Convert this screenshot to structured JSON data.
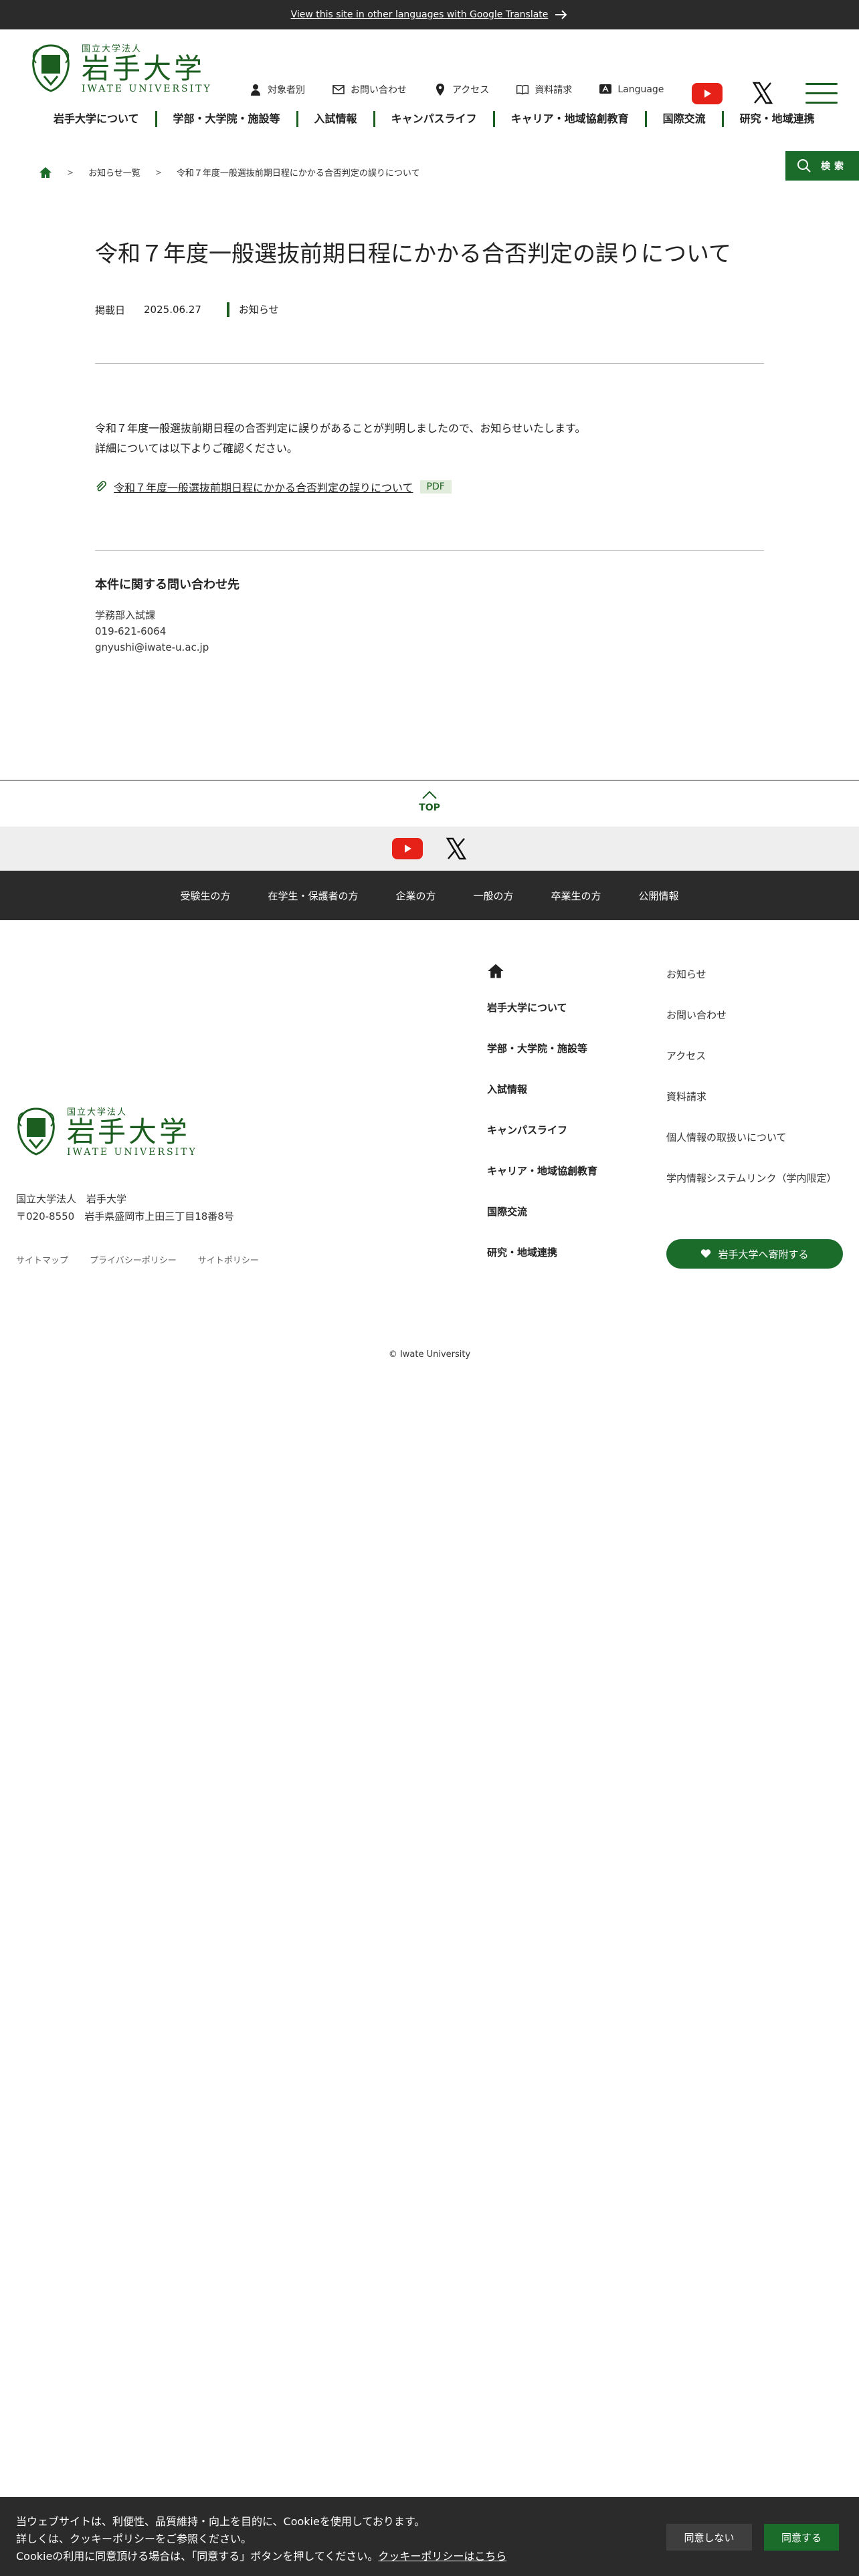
{
  "topbar": {
    "translate_link": "View this site in other languages with Google Translate"
  },
  "logo": {
    "small": "国立大学法人",
    "big": "岩手大学",
    "en": "IWATE UNIVERSITY"
  },
  "util_nav": [
    {
      "label": "対象者別",
      "icon": "person-icon"
    },
    {
      "label": "お問い合わせ",
      "icon": "mail-icon"
    },
    {
      "label": "アクセス",
      "icon": "map-pin-icon"
    },
    {
      "label": "資料請求",
      "icon": "book-icon"
    },
    {
      "label": "Language",
      "icon": "language-icon"
    }
  ],
  "global_nav": [
    "岩手大学について",
    "学部・大学院・施設等",
    "入試情報",
    "キャンパスライフ",
    "キャリア・地域協創教育",
    "国際交流",
    "研究・地域連携"
  ],
  "search": {
    "label": "検索"
  },
  "breadcrumb": {
    "items": [
      "お知らせ一覧",
      "令和７年度一般選抜前期日程にかかる合否判定の誤りについて"
    ]
  },
  "article": {
    "title": "令和７年度一般選抜前期日程にかかる合否判定の誤りについて",
    "date_label": "掲載日",
    "date": "2025.06.27",
    "category": "お知らせ",
    "body_line1": "令和７年度一般選抜前期日程の合否判定に誤りがあることが判明しましたので、お知らせいたします。",
    "body_line2": "詳細については以下よりご確認ください。",
    "attachment_label": "令和７年度一般選抜前期日程にかかる合否判定の誤りについて",
    "attachment_type": "PDF"
  },
  "contact": {
    "heading": "本件に関する問い合わせ先",
    "dept": "学務部入試課",
    "phone": "019-621-6064",
    "email": "gnyushi@iwate-u.ac.jp"
  },
  "totop": {
    "label": "TOP"
  },
  "audience_nav": [
    "受験生の方",
    "在学生・保護者の方",
    "企業の方",
    "一般の方",
    "卒業生の方",
    "公開情報"
  ],
  "footer": {
    "org": "国立大学法人　岩手大学",
    "address": "〒020-8550　岩手県盛岡市上田三丁目18番8号",
    "links": [
      "サイトマップ",
      "プライバシーポリシー",
      "サイトポリシー"
    ],
    "nav_main": [
      "岩手大学について",
      "学部・大学院・施設等",
      "入試情報",
      "キャンパスライフ",
      "キャリア・地域協創教育",
      "国際交流",
      "研究・地域連携"
    ],
    "nav_sub": [
      "お知らせ",
      "お問い合わせ",
      "アクセス",
      "資料請求",
      "個人情報の取扱いについて",
      "学内情報システムリンク（学内限定）"
    ],
    "donate_label": "岩手大学へ寄附する",
    "copyright": "© Iwate University"
  },
  "cookie": {
    "line1": "当ウェブサイトは、利便性、品質維持・向上を目的に、Cookieを使用しております。",
    "line2": "詳しくは、クッキーポリシーをご参照ください。",
    "line3": "Cookieの利用に同意頂ける場合は、「同意する」ボタンを押してください。",
    "policy_link": "クッキーポリシーはこちら",
    "deny_label": "同意しない",
    "accept_label": "同意する"
  },
  "colors": {
    "brand_green": "#1b5e20",
    "button_green": "#1b6b2b",
    "dark_band": "#2b2b2b",
    "youtube_red": "#e62117"
  }
}
